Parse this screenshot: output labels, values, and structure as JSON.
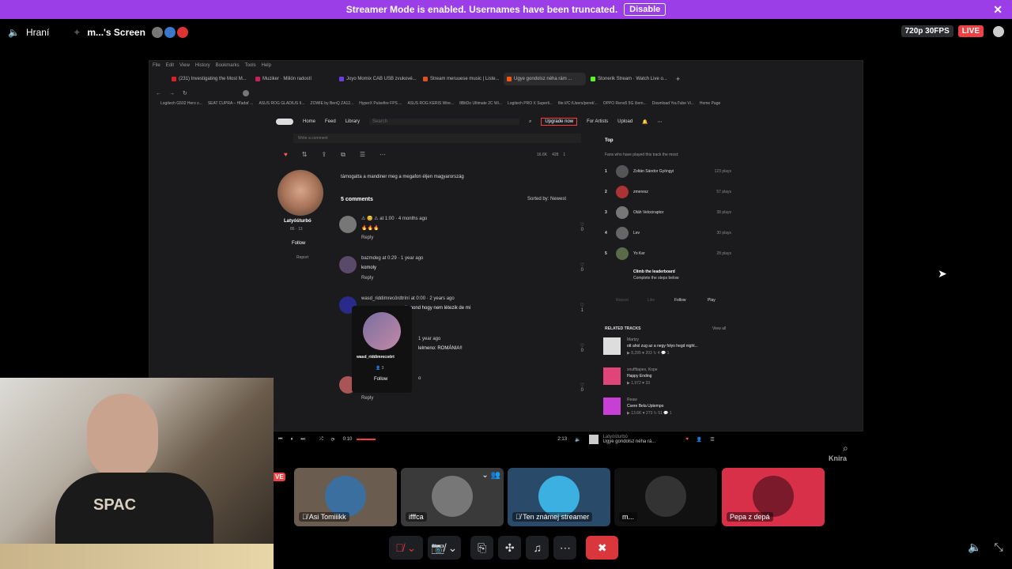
{
  "banner": {
    "text": "Streamer Mode is enabled. Usernames have been truncated.",
    "button": "Disable",
    "close": "✕"
  },
  "stream_header": {
    "channel": "Hraní",
    "screen_label": "m...'s Screen",
    "quality": "720p 30FPS",
    "live": "LIVE"
  },
  "browser": {
    "menu": [
      "File",
      "Edit",
      "View",
      "History",
      "Bookmarks",
      "Tools",
      "Help"
    ],
    "tabs": [
      {
        "label": "(231) Investigating the Most M...",
        "color": "#e02020"
      },
      {
        "label": "Muziker · Milión radostí",
        "color": "#cc1f5a"
      },
      {
        "label": "Joyo Momix CAB USB zvukové...",
        "color": "#6a3de8"
      },
      {
        "label": "Stream meruuese music | Liste...",
        "color": "#e0501e"
      },
      {
        "label": "Ugye gondolsz néha rám ...",
        "color": "#ff5500"
      },
      {
        "label": "Stonerik Stream · Watch Live o...",
        "color": "#53fc18"
      }
    ],
    "bookmarks": [
      "Logitech G502 Hero z...",
      "SEAT CUPRA – Hľadať ...",
      "ASUS ROG GLADIUS II...",
      "ZOWIE by BenQ ZA12...",
      "HyperX Pulsefire FPS ...",
      "ASUS ROG KERIS Wire...",
      "8BitDo Ultimate 2C Wi...",
      "Logitech PRO X Superli...",
      "file:///C:/Users/peret/...",
      "OPPO Reno5 5G čiern...",
      "Download YouTube Vi...",
      "Home Page"
    ]
  },
  "soundcloud": {
    "nav": {
      "home": "Home",
      "feed": "Feed",
      "library": "Library",
      "search": "Search",
      "upgrade": "Upgrade now",
      "for_artists": "For Artists",
      "upload": "Upload"
    },
    "comment_placeholder": "Write a comment",
    "stats": {
      "plays": "16.6K",
      "likes": "428",
      "reposts": "1"
    },
    "artist": {
      "name": "Latyóśturbó",
      "followers": "86",
      "tracks": "13",
      "follow": "Follow",
      "report": "Report"
    },
    "description": "támogatta a mandiner meg a megafon éljen magyarország",
    "comments_count": "5 comments",
    "sort": "Sorted by: Newest",
    "comments": [
      {
        "meta": "⚠ 😊 ⚠ at 1:00 · 4 months ago",
        "text": "🔥🔥🔥",
        "reply": "Reply",
        "likes": "0"
      },
      {
        "meta": "bazmdeg at 0:29 · 1 year ago",
        "text": "komoly",
        "reply": "Reply",
        "likes": "0"
      },
      {
        "meta": "wasd_riddimrecördtríní at 0:00 · 2 years ago",
        "text": "nit mond hogy nem létezik de mi",
        "reply": "",
        "likes": "1"
      },
      {
        "meta": "1 year ago",
        "text": "lelmeno: ROMÁNIA!!",
        "reply": "",
        "likes": "0"
      },
      {
        "meta": "o",
        "text": "",
        "reply": "Reply",
        "likes": "0"
      }
    ],
    "hover_card": {
      "name": "wasd_riddimrecoört",
      "followers": "3",
      "follow": "Follow"
    },
    "fans": {
      "title": "Top",
      "subtitle": "Fans who have played this track the most:",
      "list": [
        {
          "rank": "1",
          "name": "Zoltán Sándor Gyöngyi",
          "plays": "123 plays"
        },
        {
          "rank": "2",
          "name": "zmeresz",
          "plays": "57 plays"
        },
        {
          "rank": "3",
          "name": "Oláh Velociraptor",
          "plays": "38 plays"
        },
        {
          "rank": "4",
          "name": "Lev",
          "plays": "30 plays"
        },
        {
          "rank": "5",
          "name": "Yo Ker",
          "plays": "28 plays"
        }
      ],
      "leaderboard": "Climb the leaderboard",
      "leaderboard_sub": "Complete the steps below"
    },
    "actions": {
      "repost": "Repost",
      "like": "Like",
      "follow": "Follow",
      "play": "Play"
    },
    "related": {
      "title": "RELATED TRACKS",
      "view_all": "View all",
      "tracks": [
        {
          "artist": "Martzy",
          "title": "ott ahol zug az a negy folyo hegd night...",
          "stats": "▶ 8,295  ♥ 203  ↻ 4  💬 1"
        },
        {
          "artist": "snuffitapes, Kope",
          "title": "Happy Ending",
          "stats": "▶ 1,972  ♥ 33"
        },
        {
          "artist": "Reaw",
          "title": "Csere Bela Uptempo",
          "stats": "▶ 13.6K  ♥ 273  ↻ 51  💬 1"
        }
      ]
    },
    "player": {
      "elapsed": "0:10",
      "duration": "2:13",
      "artist": "Latyóśturbó",
      "title": "Ugye gondolsz néha rá..."
    }
  },
  "webcam": {
    "shirt_text": "SPAC"
  },
  "participants": [
    {
      "name": "Asi Tomiiikk",
      "bg": "#6a5c4f"
    },
    {
      "name": "ifffca",
      "bg": "#3a3a3a"
    },
    {
      "name": "Ten známej streamer",
      "bg": "#2a4a6a"
    },
    {
      "name": "m...",
      "bg": "#111111"
    },
    {
      "name": "Pepa z depá",
      "bg": "#d9304a"
    }
  ],
  "watermark": "Knira"
}
